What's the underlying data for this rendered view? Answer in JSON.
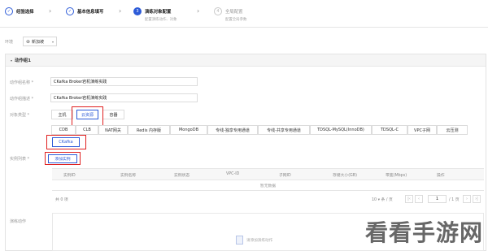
{
  "colors": {
    "accent": "#2d5bd8",
    "highlight": "#e02020"
  },
  "steps": [
    {
      "num": "✓",
      "label": "经验选择",
      "state": "done"
    },
    {
      "num": "✓",
      "label": "基本信息填写",
      "state": "done"
    },
    {
      "num": "3",
      "label": "演练对象配置",
      "sub": "配置演练动作、对象",
      "state": "active"
    },
    {
      "num": "4",
      "label": "全局配置",
      "sub": "配置全局参数",
      "state": "todo"
    }
  ],
  "env": {
    "label": "环境",
    "value": "新加坡"
  },
  "group": {
    "title": "动作组1",
    "name_label": "动作组名称 *",
    "name_value": "CKafka Broker宕机演练实践",
    "desc_label": "动作组描述 *",
    "desc_value": "CKafka Broker宕机演练实践",
    "type_label": "对象类型 *",
    "type_tabs": [
      "主机",
      "云资源",
      "容器"
    ],
    "resource_tabs": [
      "CDB",
      "CLB",
      "NAT网关",
      "Redis 内存版",
      "MongoDB",
      "专线-独享专用通道",
      "专线-共享专用通道",
      "TDSQL-MySQL(InnoDB)",
      "TDSQL-C",
      "VPC子网",
      "云压测"
    ],
    "ckafka_tab": "CKafka",
    "instance_label": "实例列表 *",
    "add_instance": "添加实例",
    "columns": [
      "实例ID",
      "实例名称",
      "实例状态",
      "VPC-ID",
      "子网ID",
      "存储大小(GB)",
      "带宽(Mbps)",
      "操作"
    ],
    "empty_text": "暂无数据",
    "total": "共 0 项",
    "page_size": "10 ▾ 条 / 页",
    "page_num": "1",
    "page_total": "/ 1 页",
    "action_label": "演练动作",
    "action_empty": "请添加演练动作"
  },
  "watermark": "看看手游网"
}
